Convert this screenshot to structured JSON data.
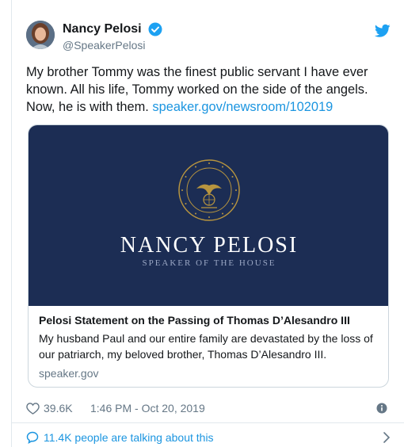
{
  "user": {
    "name": "Nancy Pelosi",
    "handle": "@SpeakerPelosi",
    "verified": true
  },
  "tweet": {
    "text": "My brother Tommy was the finest public servant I have ever known. All his life, Tommy worked on the side of the angels. Now, he is with them. ",
    "link": "speaker.gov/newsroom/102019"
  },
  "card": {
    "image_title": "NANCY PELOSI",
    "image_subtitle": "SPEAKER OF THE HOUSE",
    "title": "Pelosi Statement on the Passing of Thomas D’Alesandro III",
    "description": "My husband Paul and our entire family are devastated by the loss of our patriarch, my beloved brother, Thomas D’Alesandro III.",
    "domain": "speaker.gov"
  },
  "meta": {
    "likes": "39.6K",
    "timestamp": "1:46 PM - Oct 20, 2019"
  },
  "footer": {
    "talking": "11.4K people are talking about this"
  },
  "colors": {
    "link": "#1b95e0",
    "card_bg": "#1c2d54",
    "seal_gold": "#b8953f"
  },
  "icons": [
    "verified-badge-icon",
    "twitter-logo-icon",
    "heart-icon",
    "info-icon",
    "speech-bubble-icon",
    "chevron-right-icon"
  ]
}
